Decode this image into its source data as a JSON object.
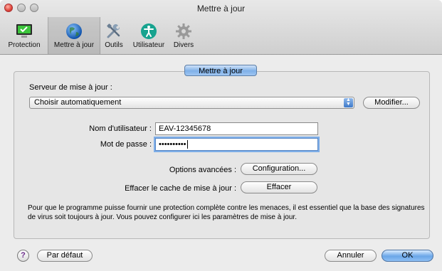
{
  "window": {
    "title": "Mettre à jour"
  },
  "toolbar": {
    "items": [
      {
        "label": "Protection",
        "icon": "monitor-check-icon"
      },
      {
        "label": "Mettre à jour",
        "icon": "globe-icon"
      },
      {
        "label": "Outils",
        "icon": "tools-icon"
      },
      {
        "label": "Utilisateur",
        "icon": "accessibility-icon"
      },
      {
        "label": "Divers",
        "icon": "gear-icon"
      }
    ],
    "selected": "Mettre à jour"
  },
  "section_tab": {
    "label": "Mettre à jour"
  },
  "server": {
    "label": "Serveur de mise à jour :",
    "selected": "Choisir automatiquement",
    "modify_button": "Modifier..."
  },
  "credentials": {
    "username_label": "Nom d'utilisateur :",
    "username_value": "EAV-12345678",
    "password_label": "Mot de passe :",
    "password_value": "••••••••••"
  },
  "advanced": {
    "label": "Options avancées :",
    "button": "Configuration..."
  },
  "cache": {
    "label": "Effacer le cache de mise à jour :",
    "button": "Effacer"
  },
  "info_text": "Pour que le programme puisse fournir une protection complète contre les menaces, il est essentiel que la base des signatures de virus soit toujours à jour. Vous pouvez configurer ici les paramètres de mise à jour.",
  "footer": {
    "help_symbol": "?",
    "default_button": "Par défaut",
    "cancel_button": "Annuler",
    "ok_button": "OK"
  },
  "colors": {
    "accent": "#6aa6e8",
    "close_button": "#e0443a"
  }
}
